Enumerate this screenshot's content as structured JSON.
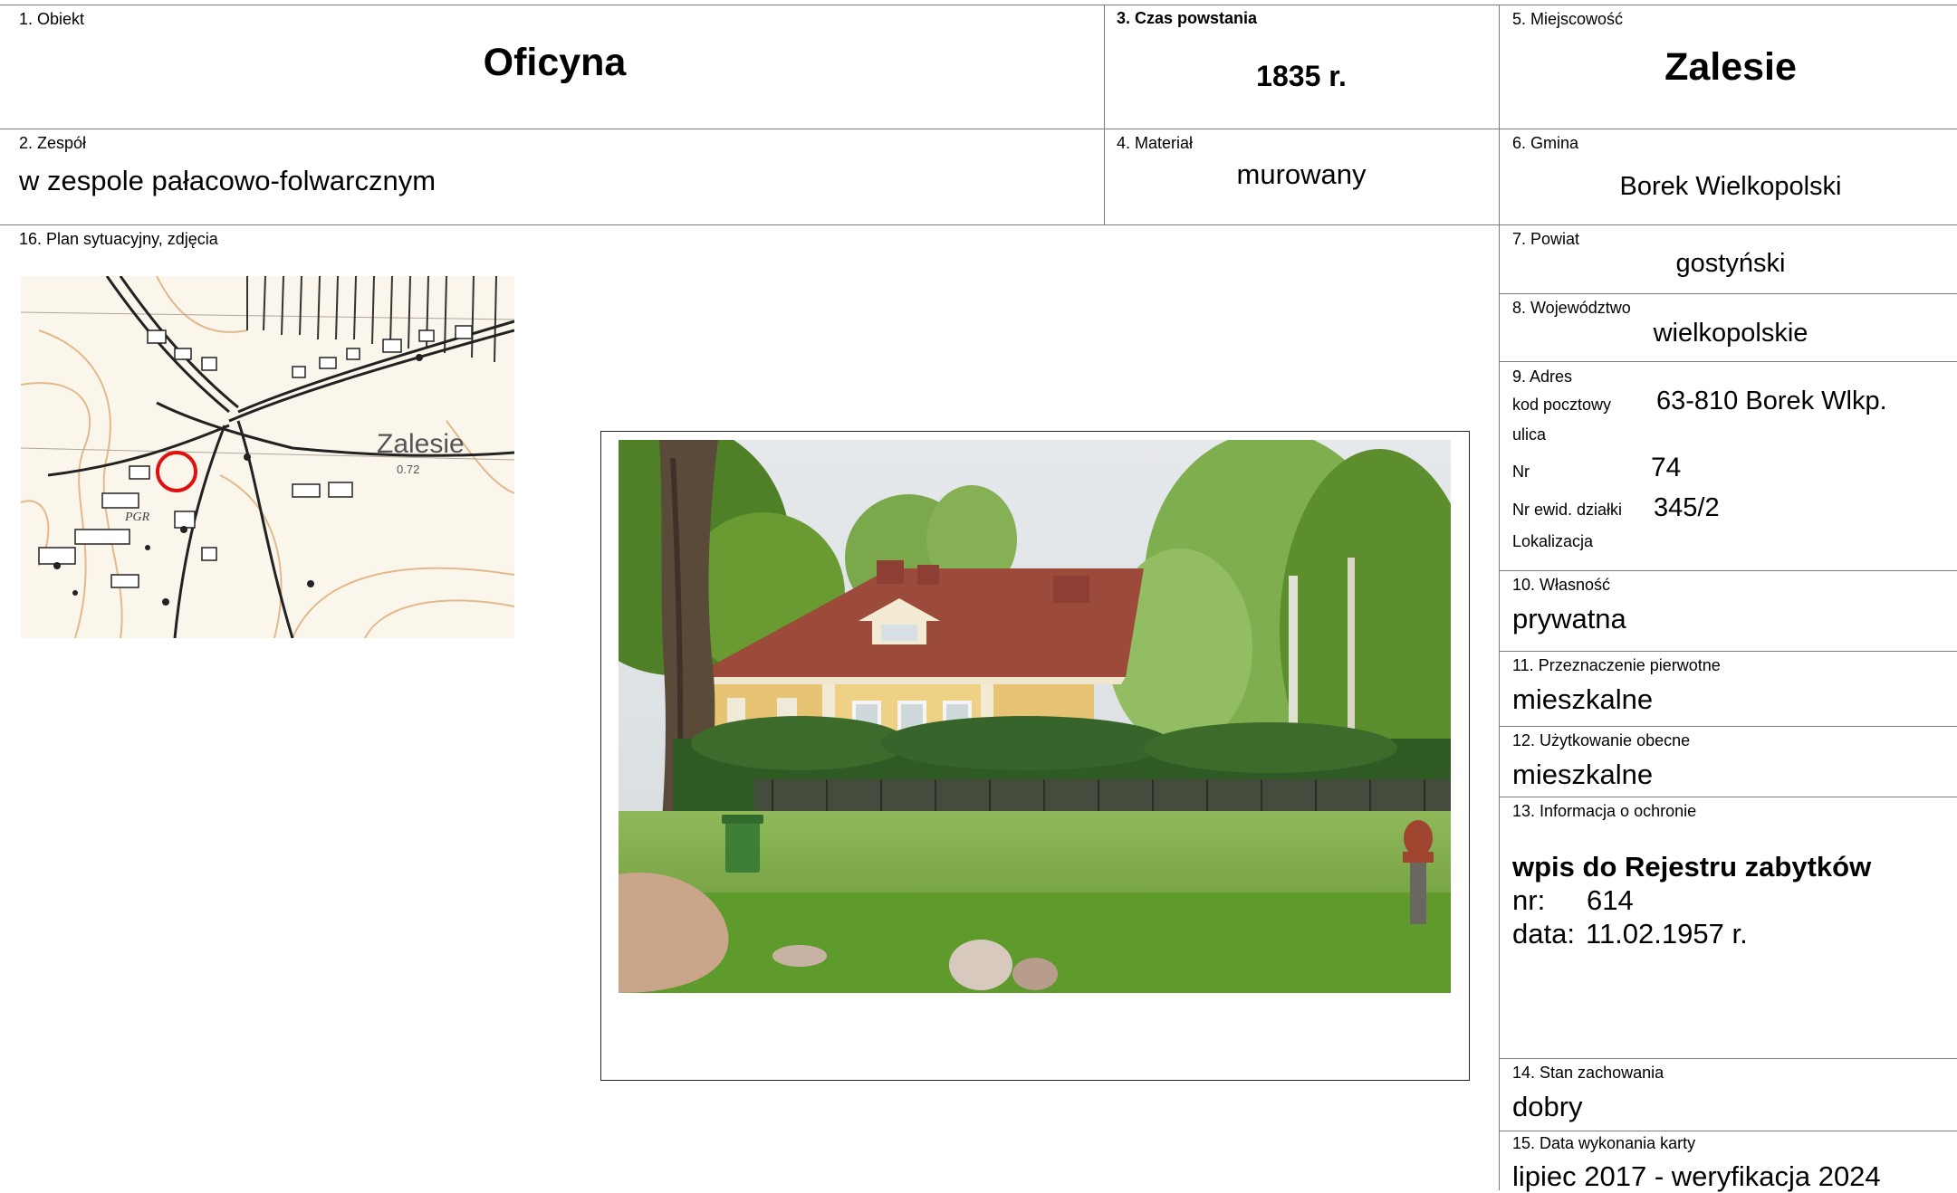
{
  "fields": {
    "obiekt": {
      "label": "1. Obiekt",
      "value": "Oficyna"
    },
    "czas": {
      "label": "3. Czas powstania",
      "value": "1835 r."
    },
    "miejscowosc": {
      "label": "5. Miejscowość",
      "value": "Zalesie"
    },
    "zespol": {
      "label": "2. Zespół",
      "value": "w zespole pałacowo-folwarcznym"
    },
    "material": {
      "label": "4. Materiał",
      "value": "murowany"
    },
    "gmina": {
      "label": "6. Gmina",
      "value": "Borek Wielkopolski"
    },
    "plan": {
      "label": "16. Plan sytuacyjny, zdjęcia"
    },
    "powiat": {
      "label": "7. Powiat",
      "value": "gostyński"
    },
    "wojewodztwo": {
      "label": "8. Województwo",
      "value": "wielkopolskie"
    },
    "adres": {
      "label": "9. Adres",
      "kod_label": "kod pocztowy",
      "kod_value": "63-810 Borek Wlkp.",
      "ulica_label": "ulica",
      "nr_label": "Nr",
      "nr_value": "74",
      "dzialka_label": "Nr ewid. działki",
      "dzialka_value": "345/2",
      "lokalizacja_label": "Lokalizacja"
    },
    "wlasnosc": {
      "label": "10. Własność",
      "value": "prywatna"
    },
    "przeznaczenie": {
      "label": "11. Przeznaczenie pierwotne",
      "value": "mieszkalne"
    },
    "uzytkowanie": {
      "label": "12. Użytkowanie obecne",
      "value": "mieszkalne"
    },
    "ochrona": {
      "label": "13. Informacja o ochronie",
      "title": "wpis do Rejestru zabytków",
      "nr_label": "nr:",
      "nr_value": "614",
      "data_label": "data:",
      "data_value": "11.02.1957 r."
    },
    "stan": {
      "label": "14. Stan zachowania",
      "value": "dobry"
    },
    "data_karty": {
      "label": "15. Data wykonania karty",
      "value": "lipiec 2017 - weryfikacja 2024"
    }
  },
  "map": {
    "place_label": "Zalesie",
    "scale_label": "0.72",
    "pgr_label": "PGR"
  }
}
